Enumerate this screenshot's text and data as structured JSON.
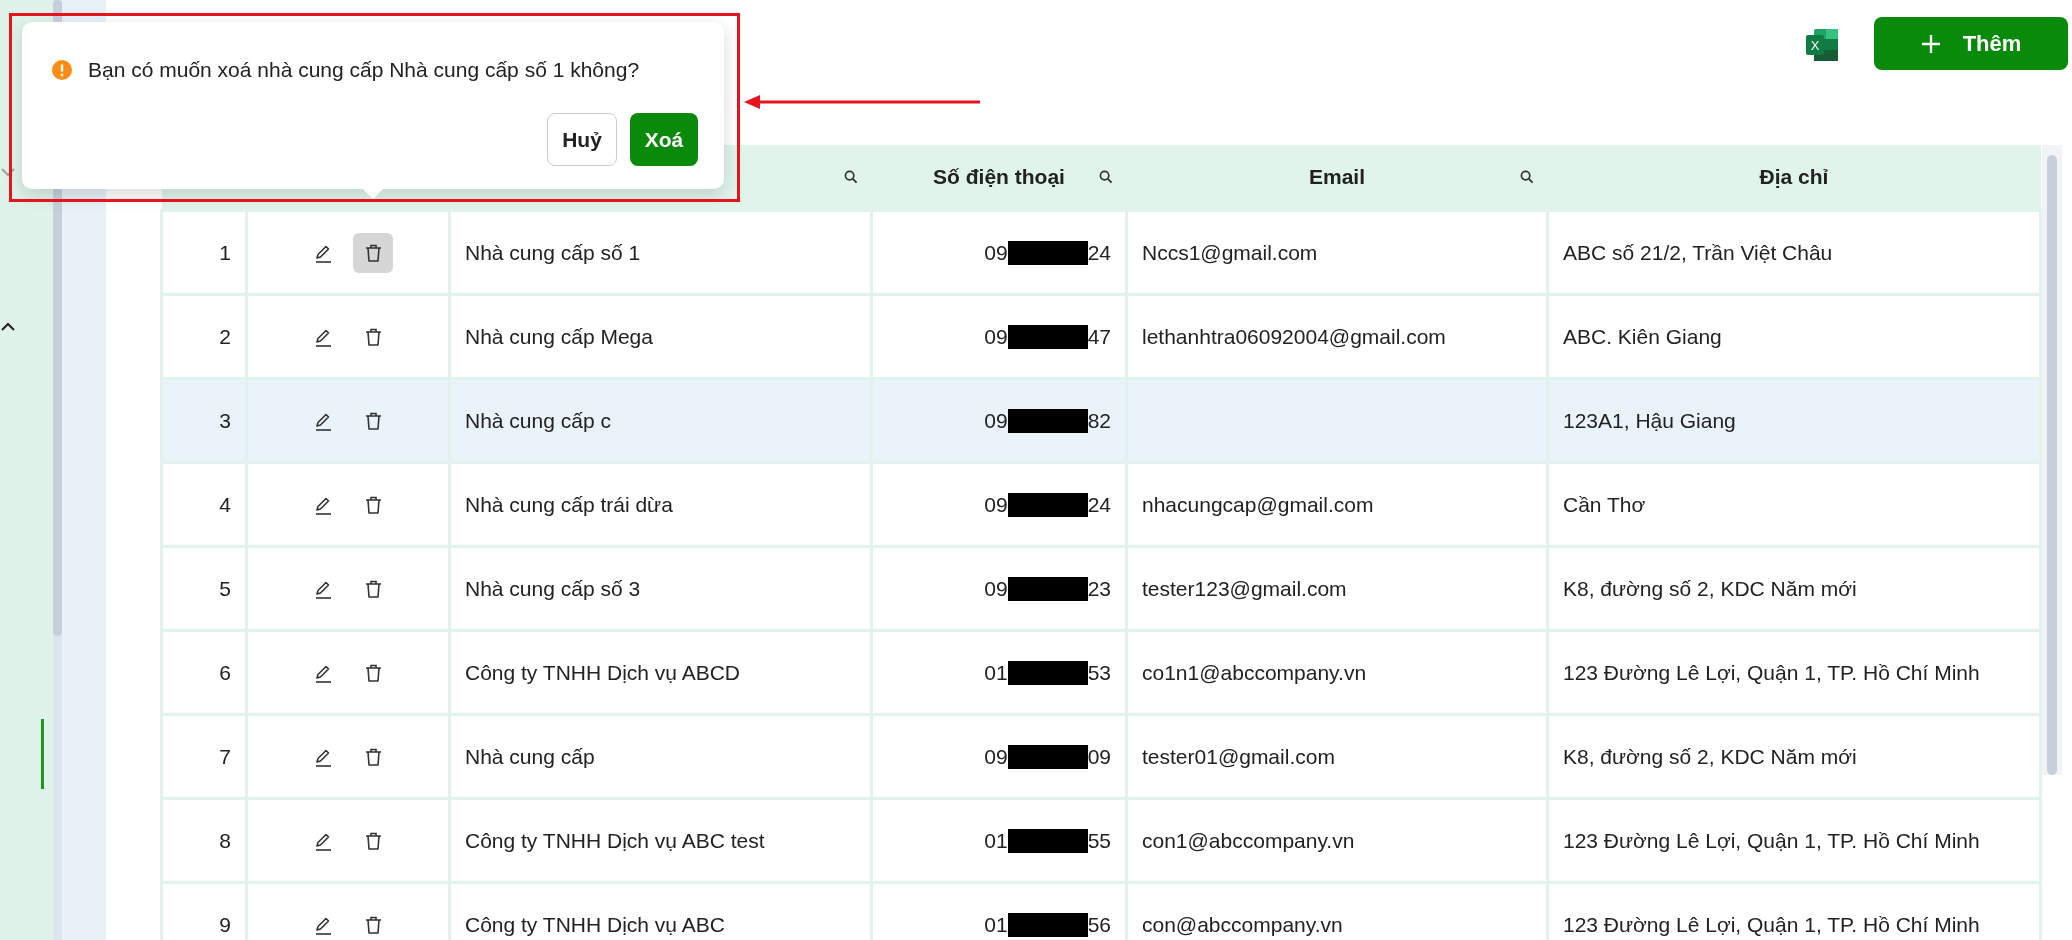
{
  "toolbar": {
    "export_button": {
      "icon_letter": "X"
    },
    "add_button": {
      "label": "Thêm"
    }
  },
  "table": {
    "columns": [
      {
        "kind": "index"
      },
      {
        "kind": "actions"
      },
      {
        "kind": "name",
        "searchable": true
      },
      {
        "kind": "phone",
        "label": "Số điện thoại",
        "searchable": true
      },
      {
        "kind": "email",
        "label": "Email",
        "searchable": true
      },
      {
        "kind": "address",
        "label": "Địa chỉ",
        "searchable": false
      }
    ],
    "rows": [
      {
        "index": "1",
        "name": "Nhà cung cấp số 1",
        "phone_start": "09",
        "phone_end": "24",
        "email": "Nccs1@gmail.com",
        "address": "ABC số 21/2, Trần Việt Châu",
        "highlighted": false,
        "delete_active": true
      },
      {
        "index": "2",
        "name": "Nhà cung cấp Mega",
        "phone_start": "09",
        "phone_end": "47",
        "email": "lethanhtra06092004@gmail.com",
        "address": "ABC. Kiên Giang",
        "highlighted": false,
        "delete_active": false
      },
      {
        "index": "3",
        "name": "Nhà cung cấp c",
        "phone_start": "09",
        "phone_end": "82",
        "address": "123A1, Hậu Giang",
        "highlighted": true,
        "delete_active": false
      },
      {
        "index": "4",
        "name": "Nhà cung cấp trái dừa",
        "phone_start": "09",
        "phone_end": "24",
        "email": "nhacungcap@gmail.com",
        "address": "Cần Thơ",
        "highlighted": false,
        "delete_active": false
      },
      {
        "index": "5",
        "name": "Nhà cung cấp số 3",
        "phone_start": "09",
        "phone_end": "23",
        "email": "tester123@gmail.com",
        "address": "K8, đường số 2, KDC Năm mới",
        "highlighted": false,
        "delete_active": false
      },
      {
        "index": "6",
        "name": "Công ty TNHH Dịch vụ ABCD",
        "phone_start": "01",
        "phone_end": "53",
        "email": "co1n1@abccompany.vn",
        "address": "123 Đường Lê Lợi, Quận 1, TP. Hồ Chí Minh",
        "highlighted": false,
        "delete_active": false
      },
      {
        "index": "7",
        "name": "Nhà cung cấp",
        "phone_start": "09",
        "phone_end": "09",
        "email": "tester01@gmail.com",
        "address": "K8, đường số 2, KDC Năm mới",
        "highlighted": false,
        "delete_active": false
      },
      {
        "index": "8",
        "name": "Công ty TNHH Dịch vụ ABC test",
        "phone_start": "01",
        "phone_end": "55",
        "email": "con1@abccompany.vn",
        "address": "123 Đường Lê Lợi, Quận 1, TP. Hồ Chí Minh",
        "highlighted": false,
        "delete_active": false
      },
      {
        "index": "9",
        "name": "Công ty TNHH Dịch vụ ABC",
        "phone_start": "01",
        "phone_end": "56",
        "email": "con@abccompany.vn",
        "address": "123 Đường Lê Lợi, Quận 1, TP. Hồ Chí Minh",
        "highlighted": false,
        "delete_active": false
      }
    ]
  },
  "popconfirm": {
    "message": "Bạn có muốn xoá nhà cung cấp Nhà cung cấp số 1 không?",
    "cancel": "Huỷ",
    "confirm": "Xoá"
  }
}
